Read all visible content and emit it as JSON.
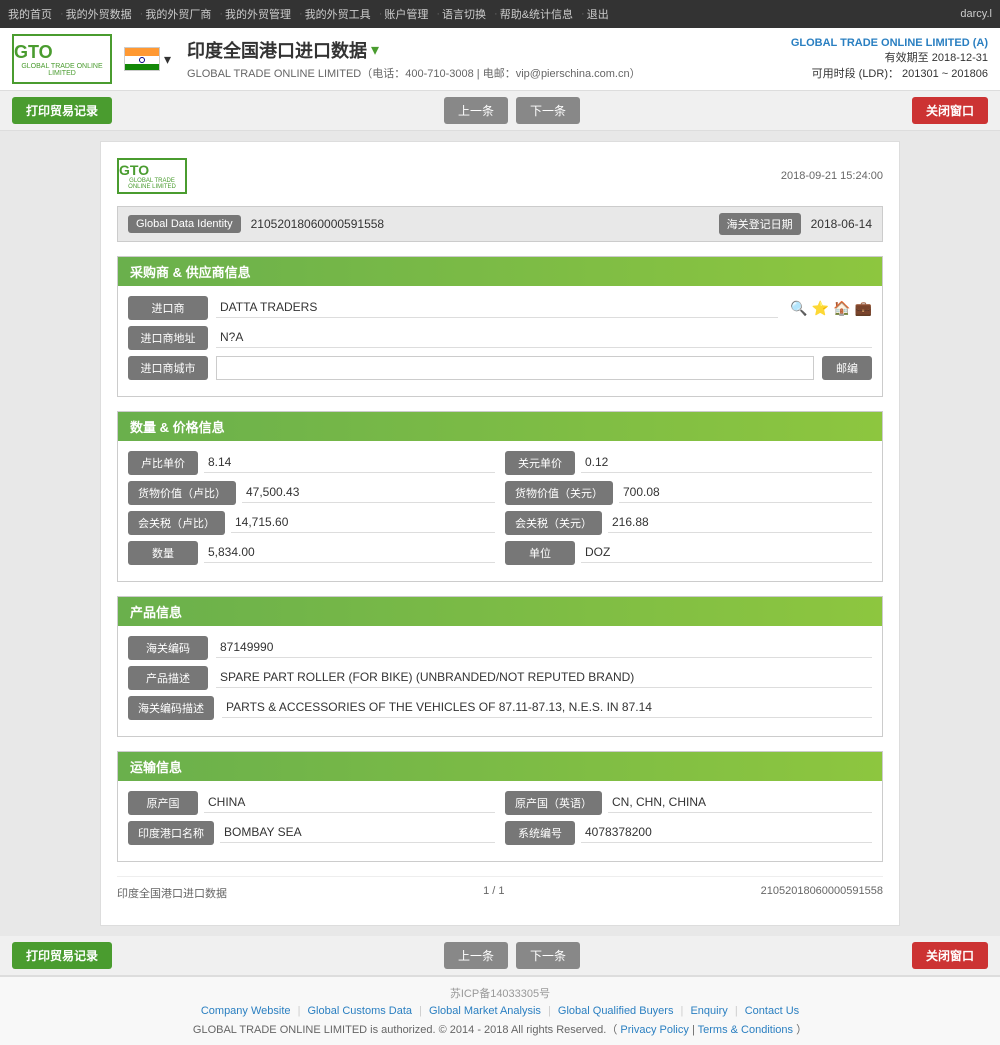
{
  "topnav": {
    "items": [
      "我的首页",
      "我的外贸数据",
      "我的外贸厂商",
      "我的外贸管理",
      "我的外贸工具",
      "账户管理",
      "语言切换",
      "帮助&统计信息",
      "退出"
    ],
    "user": "darcy.l"
  },
  "header": {
    "logo_line1": "GTO",
    "logo_line2": "GLOBAL TRADE ONLINE LIMITED",
    "page_title": "印度全国港口进口数据",
    "page_title_dropdown": "▾",
    "company_info": "GLOBAL TRADE ONLINE LIMITED（电话：400-710-3008 | 电邮：vip@pierschina.com.cn）",
    "company_header": "GLOBAL TRADE ONLINE LIMITED (A)",
    "validity_label": "有效期至",
    "validity_range": "2018-12-31",
    "ldr_label": "可用时段 (LDR)：",
    "ldr_range": "201301 ~ 201806"
  },
  "toolbar": {
    "print_btn": "打印贸易记录",
    "prev_btn": "上一条",
    "next_btn": "下一条",
    "close_btn": "关闭窗口"
  },
  "record": {
    "timestamp": "2018-09-21 15:24:00",
    "identity_label": "Global Data Identity",
    "identity_value": "21052018060000591558",
    "customs_date_label": "海关登记日期",
    "customs_date_value": "2018-06-14",
    "buyer_supplier_section": "采购商 & 供应商信息",
    "importer_label": "进口商",
    "importer_value": "DATTA TRADERS",
    "importer_address_label": "进口商地址",
    "importer_address_value": "N?A",
    "importer_city_label": "进口商城市",
    "importer_city_value": "",
    "postal_label": "邮编",
    "quantity_price_section": "数量 & 价格信息",
    "rupee_unit_label": "卢比单价",
    "rupee_unit_value": "8.14",
    "usd_unit_label": "关元单价",
    "usd_unit_value": "0.12",
    "goods_value_rupee_label": "货物价值（卢比）",
    "goods_value_rupee_value": "47,500.43",
    "goods_value_usd_label": "货物价值（关元）",
    "goods_value_usd_value": "700.08",
    "customs_tax_rupee_label": "会关税（卢比）",
    "customs_tax_rupee_value": "14,715.60",
    "customs_tax_usd_label": "会关税（关元）",
    "customs_tax_usd_value": "216.88",
    "quantity_label": "数量",
    "quantity_value": "5,834.00",
    "unit_label": "单位",
    "unit_value": "DOZ",
    "product_section": "产品信息",
    "customs_code_label": "海关编码",
    "customs_code_value": "87149990",
    "product_desc_label": "产品描述",
    "product_desc_value": "SPARE PART ROLLER (FOR BIKE) (UNBRANDED/NOT REPUTED BRAND)",
    "customs_code_desc_label": "海关编码描述",
    "customs_code_desc_value": "PARTS & ACCESSORIES OF THE VEHICLES OF 87.11-87.13, N.E.S. IN 87.14",
    "transport_section": "运输信息",
    "origin_country_label": "原产国",
    "origin_country_value": "CHINA",
    "origin_country_en_label": "原产国（英语）",
    "origin_country_en_value": "CN, CHN, CHINA",
    "india_port_label": "印度港口名称",
    "india_port_value": "BOMBAY SEA",
    "system_code_label": "系统编号",
    "system_code_value": "4078378200",
    "footer_source": "印度全国港口进口数据",
    "footer_page": "1 / 1",
    "footer_id": "21052018060000591558"
  },
  "page_footer": {
    "icp": "苏ICP备14033305号",
    "links": [
      "Company Website",
      "Global Customs Data",
      "Global Market Analysis",
      "Global Qualified Buyers",
      "Enquiry",
      "Contact Us"
    ],
    "copyright": "GLOBAL TRADE ONLINE LIMITED is authorized. © 2014 - 2018 All rights Reserved.（",
    "privacy": "Privacy Policy",
    "sep": "|",
    "terms": "Terms & Conditions",
    "close_paren": "）"
  }
}
